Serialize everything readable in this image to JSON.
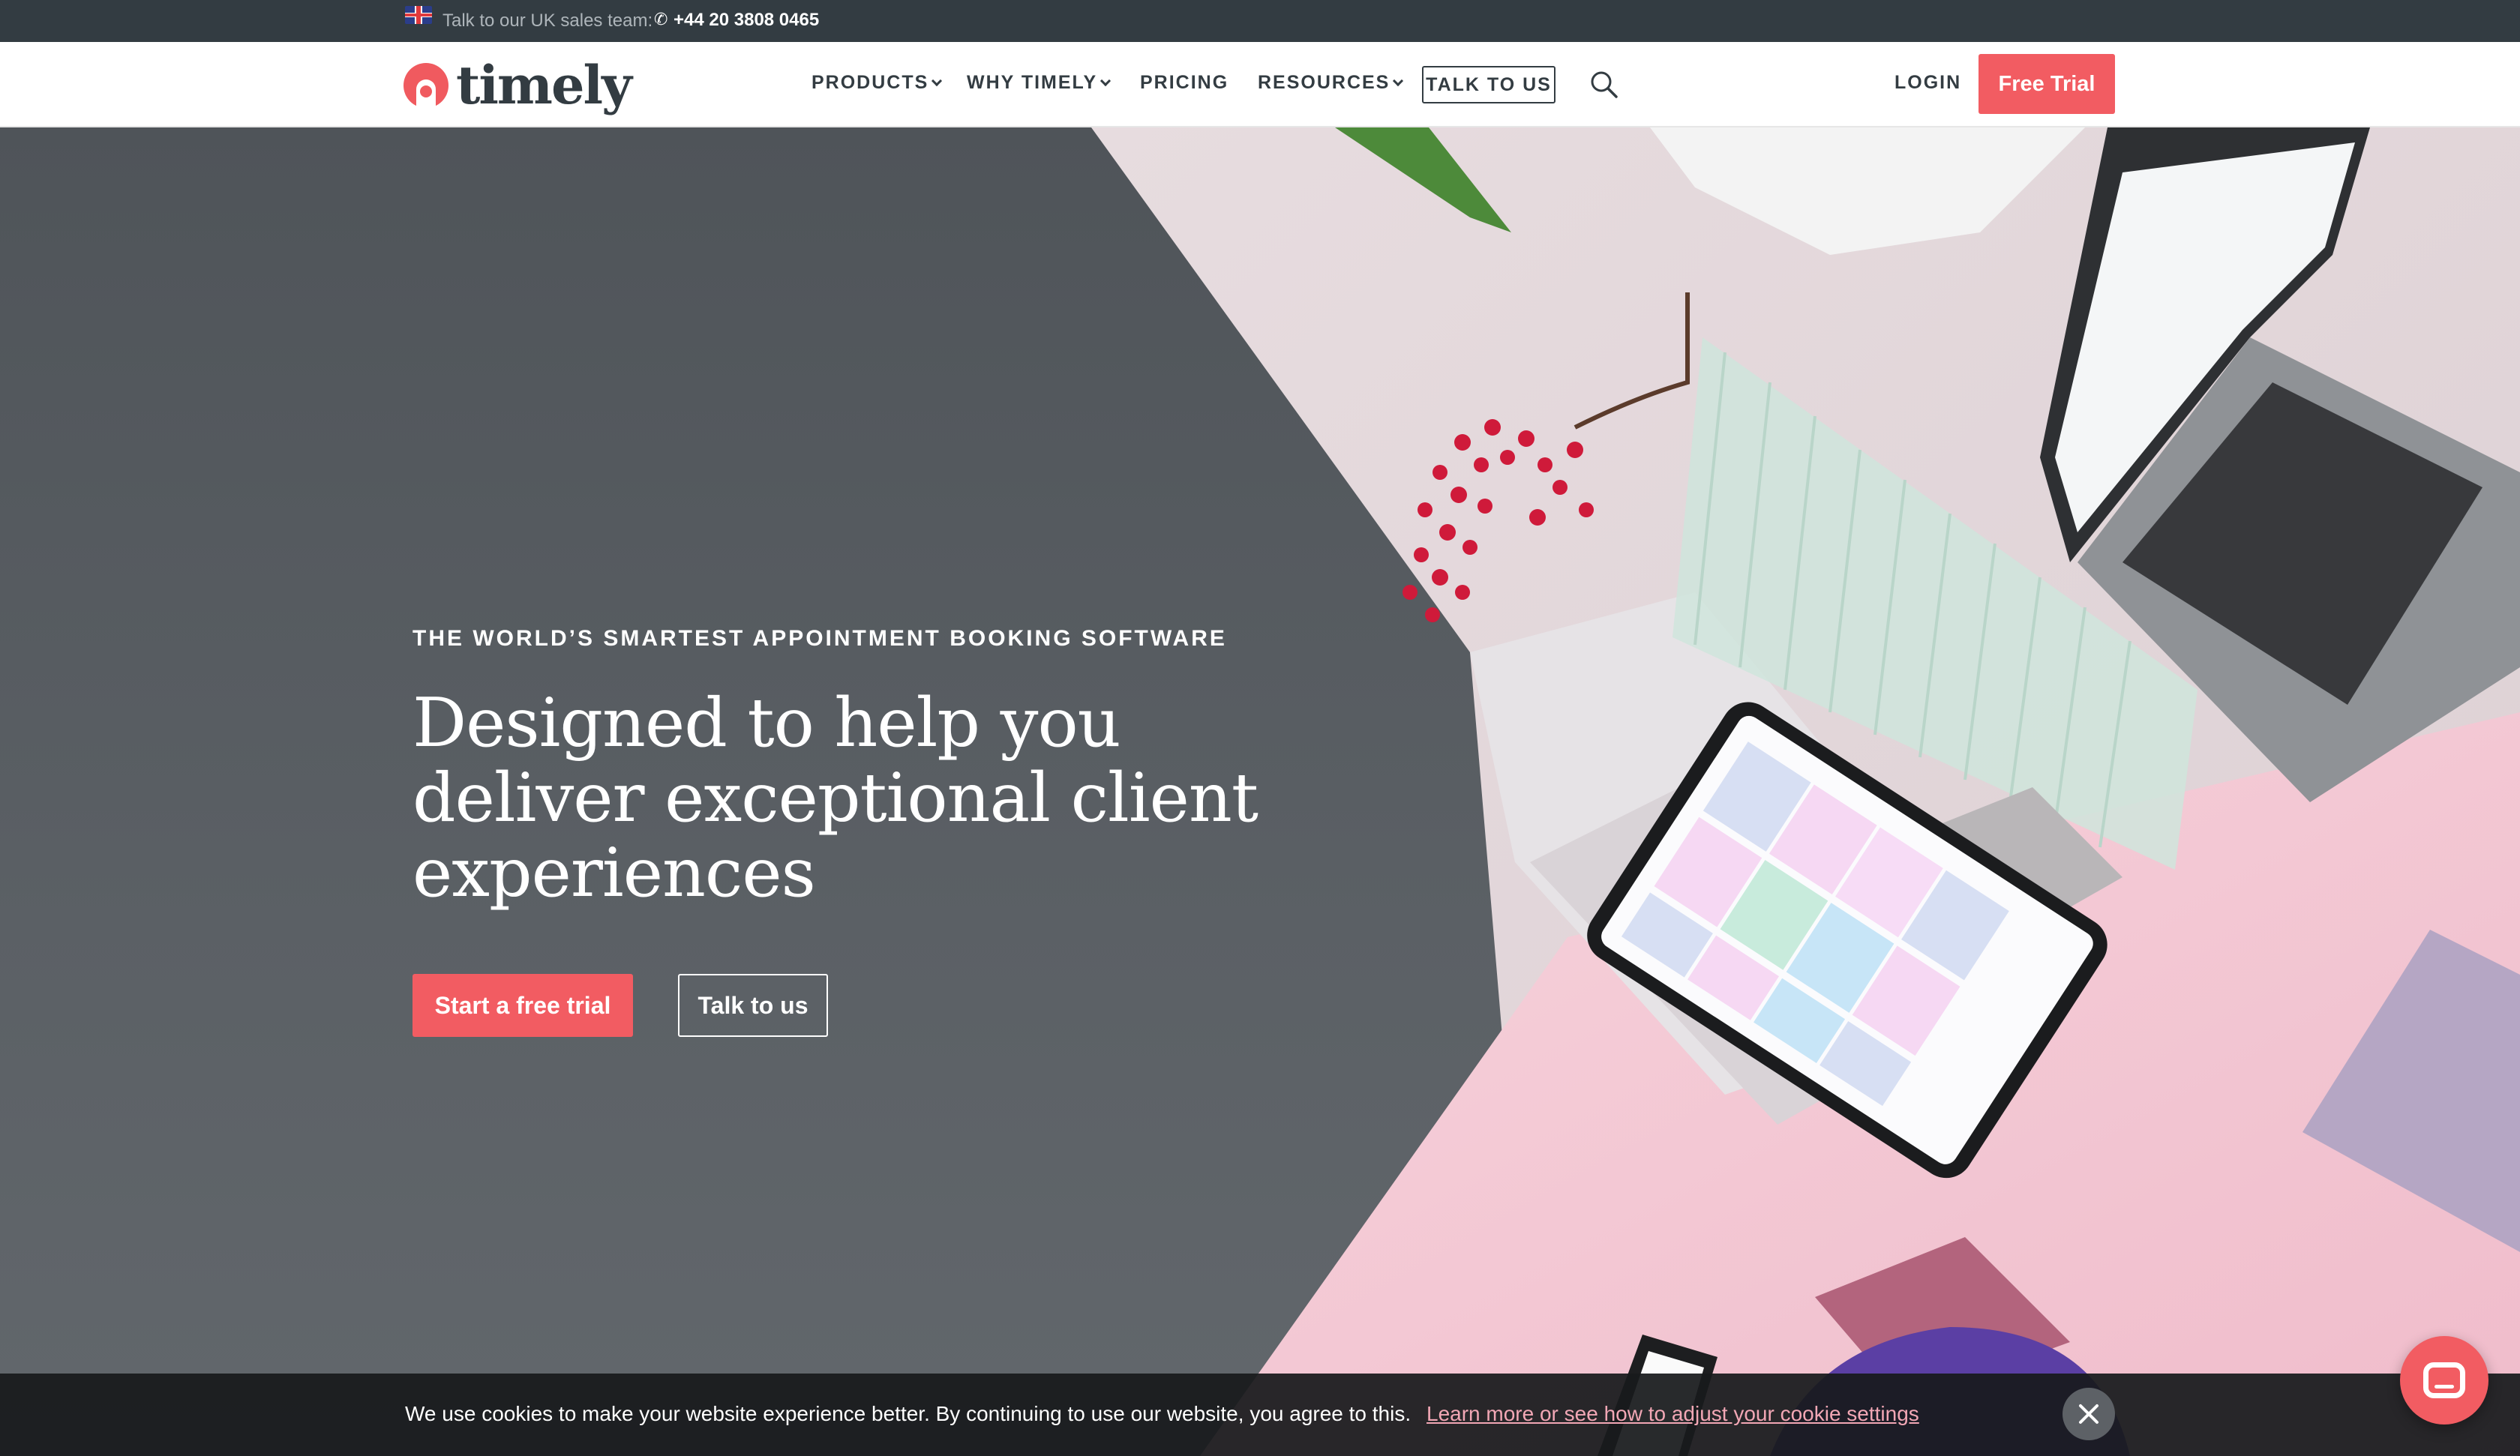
{
  "topbar": {
    "sales_label": "Talk to our UK sales team:",
    "phone": "+44 20 3808 0465",
    "flag_icon": "uk-flag-icon",
    "phone_icon": "phone-icon"
  },
  "nav": {
    "logo_text": "timely",
    "items": [
      {
        "label": "PRODUCTS",
        "has_dropdown": true
      },
      {
        "label": "WHY TIMELY",
        "has_dropdown": true
      },
      {
        "label": "PRICING",
        "has_dropdown": false
      },
      {
        "label": "RESOURCES",
        "has_dropdown": true
      }
    ],
    "talk_label": "TALK TO US",
    "search_icon": "search-icon",
    "login_label": "LOGIN",
    "free_trial_label": "Free Trial"
  },
  "hero": {
    "eyebrow": "THE WORLD’S SMARTEST APPOINTMENT BOOKING SOFTWARE",
    "headline_line1": "Designed to help you",
    "headline_line2": "deliver exceptional client",
    "headline_line3": "experiences",
    "primary_cta": "Start a free trial",
    "secondary_cta": "Talk to us"
  },
  "cookie": {
    "message": "We use cookies to make your website experience better. By continuing to use our website, you agree to this.",
    "link": "Learn more or see how to adjust your cookie settings",
    "close_icon": "close-icon"
  },
  "chat": {
    "icon": "chat-icon"
  },
  "colors": {
    "accent": "#f25c62",
    "topbar_bg": "#333c42",
    "hero_bg": "#565a5e",
    "nav_text": "#333c42"
  }
}
